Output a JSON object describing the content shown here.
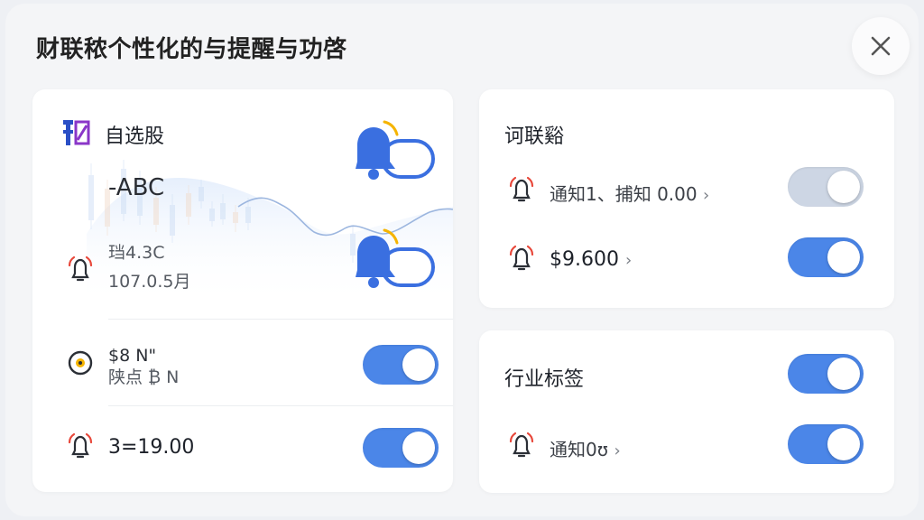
{
  "header": {
    "title": "财联秾个性化的与提醒与功啓",
    "close_icon": "close-icon"
  },
  "watchlist_card": {
    "logo_icon": "brand-logo-icon",
    "title": "自选股",
    "ticker": "-ABC",
    "line1": "珰4.3C",
    "line2": "107.0.5",
    "line2_suffix": "月",
    "row2_line1": "$8 N\"",
    "row2_line2": "陕点 ₿ N",
    "row3_value": "3=19.00",
    "bell_badge_icons": [
      "bell-toggle-icon",
      "bell-toggle-icon"
    ],
    "toggles": [
      true,
      true
    ]
  },
  "linked_card": {
    "title": "诃联谿",
    "rows": [
      {
        "icon": "bell-alert-icon",
        "label": "通知1、捕知 0.00",
        "chevron": "›",
        "enabled": false
      },
      {
        "icon": "bell-alert-icon",
        "label": "$9.600",
        "chevron": "›",
        "enabled": true
      }
    ]
  },
  "industry_card": {
    "title": "行业标签",
    "title_toggle": true,
    "rows": [
      {
        "icon": "bell-alert-icon",
        "label": "通知0ʊ",
        "chevron": "›",
        "enabled": true
      }
    ]
  },
  "colors": {
    "accent": "#4b86e8",
    "toggle_off": "#cdd6e4",
    "bell_blue": "#3a6fe0",
    "bell_badge_yellow": "#f5b400",
    "alert_red": "#e8483b"
  }
}
